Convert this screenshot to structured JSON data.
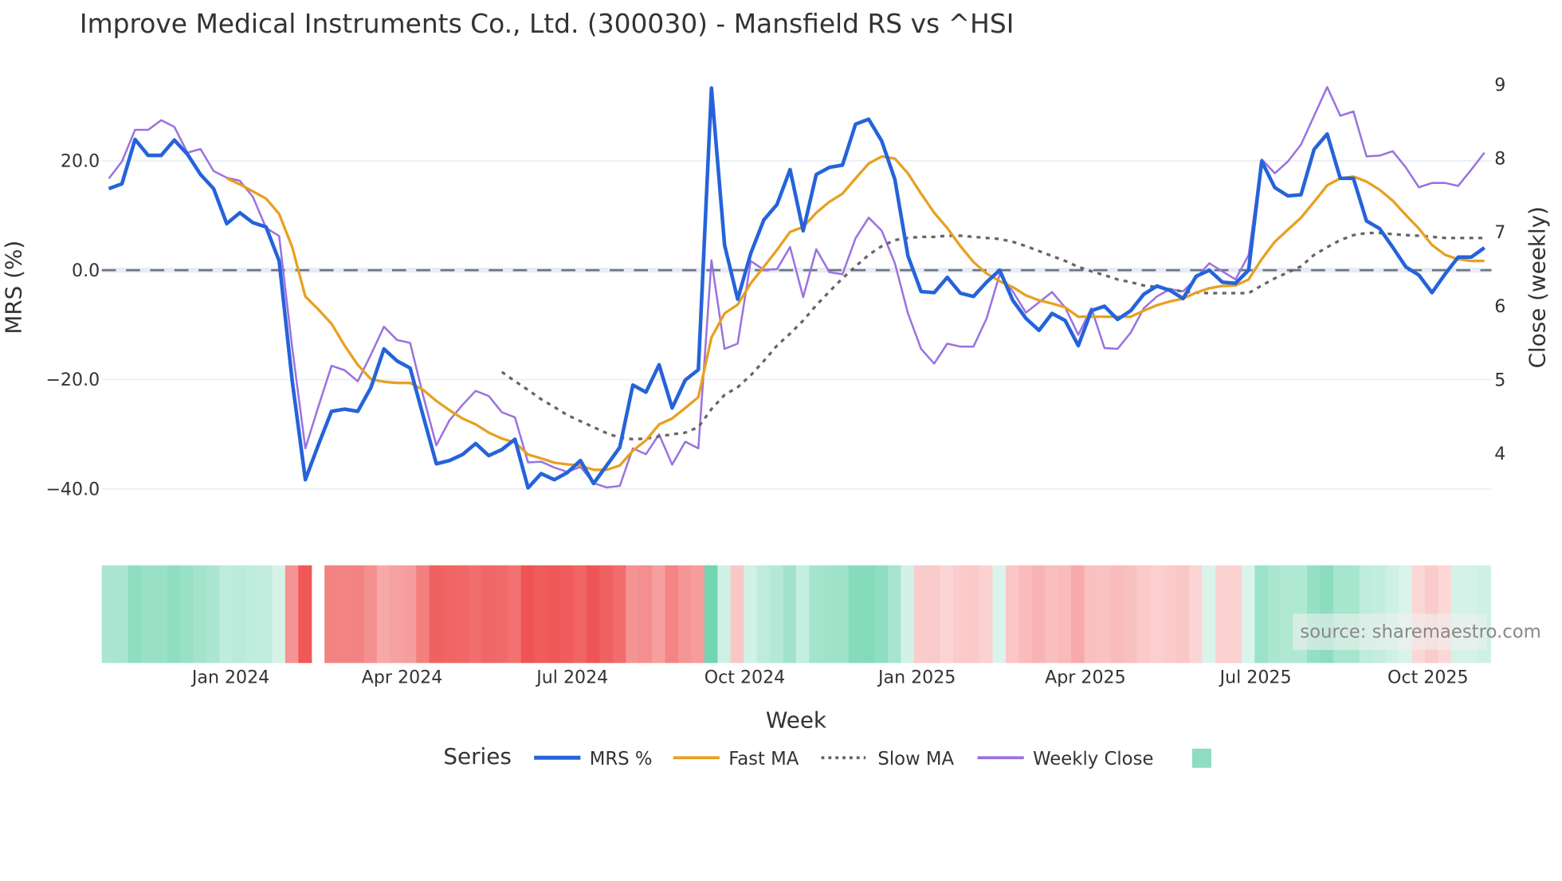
{
  "chart_data": [
    {
      "type": "line",
      "title": "Improve Medical Instruments Co., Ltd. (300030) - Mansfield RS vs ^HSI",
      "xlabel": "Week",
      "ylabel": "MRS (%)",
      "y2label": "Close (weekly)",
      "ylim": [
        -42,
        34
      ],
      "y2lim": [
        3.5,
        9.1
      ],
      "yticks": [
        "20.0",
        "0.0",
        "−20.0",
        "−40.0"
      ],
      "ytick_values": [
        20,
        0,
        -20,
        -40
      ],
      "y2ticks": [
        "9",
        "8",
        "7",
        "6",
        "5",
        "4"
      ],
      "y2tick_values": [
        9,
        8,
        7,
        6,
        5,
        4
      ],
      "xticks": [
        "Jan 2024",
        "Apr 2024",
        "Jul 2024",
        "Oct 2024",
        "Jan 2025",
        "Apr 2025",
        "Jul 2025",
        "Oct 2025"
      ],
      "x_start_week": "2023-10-27",
      "x_interval": "1 week",
      "grid": true,
      "legend_title": "Series",
      "legend_placement": "bottom",
      "series": [
        {
          "name": "MRS %",
          "color": "#2563d9",
          "axis": "left",
          "start_index": 0,
          "values": [
            14.9,
            15.8,
            23.9,
            21,
            21,
            23.8,
            21.2,
            17.5,
            14.9,
            8.5,
            10.5,
            8.7,
            7.9,
            1.7,
            -20.3,
            -38.3,
            -31.9,
            -25.8,
            -25.4,
            -25.8,
            -21.5,
            -14.4,
            -16.6,
            -17.9,
            -26.7,
            -35.4,
            -34.8,
            -33.7,
            -31.7,
            -33.9,
            -32.8,
            -30.9,
            -39.8,
            -37.2,
            -38.3,
            -37,
            -34.8,
            -39,
            -35.7,
            -32.4,
            -21,
            -22.3,
            -17.3,
            -25.2,
            -20.1,
            -18.2,
            33.3,
            4.6,
            -5.3,
            3.1,
            9.2,
            12,
            18.4,
            7.2,
            17.5,
            18.8,
            19.2,
            26.7,
            27.6,
            23.6,
            16.6,
            2.6,
            -3.9,
            -4.1,
            -1.3,
            -4.2,
            -4.8,
            -2.2,
            0,
            -5.5,
            -8.8,
            -11,
            -7.9,
            -9.2,
            -13.8,
            -7.4,
            -6.6,
            -9,
            -7.4,
            -4.4,
            -2.9,
            -3.7,
            -5.2,
            -1.1,
            0,
            -2.2,
            -2.4,
            0,
            19.9,
            15.1,
            13.6,
            13.8,
            22.1,
            24.9,
            16.8,
            16.8,
            9,
            7.6,
            4.2,
            0.6,
            -0.9,
            -4.1,
            -0.7,
            2.4,
            2.4,
            4.1
          ]
        },
        {
          "name": "Fast MA",
          "color": "#e8a020",
          "axis": "left",
          "start_index": 9,
          "values": [
            16.8,
            15.7,
            14.4,
            13.1,
            10.3,
            4.2,
            -4.8,
            -7.2,
            -9.8,
            -13.8,
            -17.3,
            -19.9,
            -20.4,
            -20.6,
            -20.6,
            -21.9,
            -23.9,
            -25.6,
            -27.1,
            -28.2,
            -29.7,
            -30.8,
            -31.5,
            -33.7,
            -34.4,
            -35.2,
            -35.5,
            -35.7,
            -36.5,
            -36.5,
            -35.7,
            -33,
            -31.1,
            -28.2,
            -27.1,
            -25.2,
            -23.2,
            -12.3,
            -7.9,
            -6.3,
            -2.4,
            0.6,
            3.7,
            7,
            7.9,
            10.5,
            12.5,
            14,
            16.8,
            19.5,
            20.8,
            20.4,
            17.7,
            14,
            10.5,
            7.7,
            4.4,
            1.5,
            -0.6,
            -2,
            -3.1,
            -4.6,
            -5.5,
            -6.1,
            -6.8,
            -8.5,
            -8.5,
            -8.5,
            -8.5,
            -8.5,
            -7.4,
            -6.4,
            -5.7,
            -5.2,
            -4.1,
            -3.3,
            -2.9,
            -2.8,
            -1.7,
            2,
            5.2,
            7.4,
            9.6,
            12.5,
            15.5,
            16.8,
            17.1,
            16.2,
            14.7,
            12.7,
            10.1,
            7.6,
            4.6,
            2.8,
            2,
            1.7,
            1.7
          ]
        },
        {
          "name": "Slow MA",
          "color": "#666666",
          "axis": "left",
          "dash": "dot",
          "start_index": 30,
          "values": [
            -18.6,
            -20.3,
            -21.9,
            -23.6,
            -25,
            -26.5,
            -27.6,
            -28.7,
            -29.8,
            -30.6,
            -30.9,
            -30.8,
            -30.4,
            -30,
            -29.7,
            -28.7,
            -25.4,
            -22.8,
            -21.4,
            -19.2,
            -16.6,
            -13.8,
            -11.6,
            -9.2,
            -6.4,
            -3.9,
            -1.5,
            0.7,
            2.8,
            4.4,
            5.5,
            5.9,
            6.1,
            6.1,
            6.3,
            6.3,
            6.1,
            5.9,
            5.7,
            5.2,
            4.4,
            3.5,
            2.6,
            1.7,
            0.6,
            -0.2,
            -0.9,
            -1.7,
            -2.2,
            -2.8,
            -3.1,
            -3.5,
            -3.9,
            -4.1,
            -4.2,
            -4.2,
            -4.2,
            -4.2,
            -2.8,
            -1.5,
            -0.4,
            0.7,
            2.8,
            4.2,
            5.5,
            6.4,
            6.8,
            6.8,
            6.6,
            6.4,
            6.3,
            6.1,
            5.9,
            5.9,
            5.9,
            5.9
          ]
        },
        {
          "name": "Weekly Close",
          "color": "#9b72e0",
          "axis": "right",
          "start_index": 0,
          "values": [
            7.73,
            7.96,
            8.39,
            8.39,
            8.52,
            8.43,
            8.08,
            8.13,
            7.83,
            7.74,
            7.7,
            7.48,
            7.06,
            6.95,
            5.43,
            4.07,
            4.64,
            5.19,
            5.13,
            4.98,
            5.34,
            5.72,
            5.54,
            5.5,
            4.78,
            4.11,
            4.45,
            4.66,
            4.85,
            4.78,
            4.56,
            4.49,
            3.88,
            3.89,
            3.81,
            3.75,
            3.82,
            3.6,
            3.54,
            3.56,
            4.07,
            3.99,
            4.26,
            3.85,
            4.16,
            4.07,
            6.62,
            5.42,
            5.49,
            6.61,
            6.49,
            6.5,
            6.8,
            6.12,
            6.77,
            6.46,
            6.43,
            6.92,
            7.2,
            7.02,
            6.58,
            5.9,
            5.42,
            5.22,
            5.49,
            5.45,
            5.45,
            5.83,
            6.43,
            6.2,
            5.91,
            6.05,
            6.19,
            5.98,
            5.61,
            5.97,
            5.43,
            5.42,
            5.64,
            5.97,
            6.13,
            6.23,
            6.2,
            6.38,
            6.58,
            6.47,
            6.36,
            6.69,
            7.99,
            7.8,
            7.96,
            8.19,
            8.58,
            8.97,
            8.58,
            8.64,
            8.03,
            8.04,
            8.1,
            7.88,
            7.61,
            7.67,
            7.67,
            7.63,
            7.85,
            8.08
          ]
        }
      ],
      "zero_line": {
        "value": 0,
        "style": "dashed",
        "color": "#6b7280"
      }
    },
    {
      "type": "heatmap",
      "description_source": "MRS % per week",
      "missing_index": [
        16
      ],
      "positive_color": "#5ccfa6",
      "negative_color": "#ef5252",
      "saturation": 40
    }
  ],
  "legend": {
    "title": "Series",
    "items": [
      "MRS %",
      "Fast MA",
      "Slow MA",
      "Weekly Close"
    ],
    "swatch_color": "#8fdcc0"
  },
  "watermark": "source: sharemaestro.com"
}
